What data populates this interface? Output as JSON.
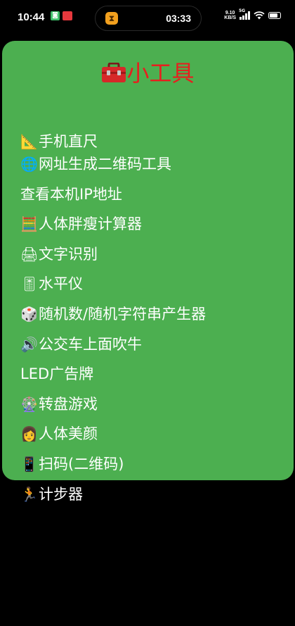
{
  "status_bar": {
    "time": "10:44",
    "timer": "03:33",
    "net_speed_value": "9.10",
    "net_speed_unit": "KB/S",
    "signal_tag": "5G",
    "battery_percent": 85,
    "text_color": "#ffffff"
  },
  "card": {
    "background": "#4caf50",
    "title": "小工具",
    "title_icon": "toolbox-icon",
    "title_color": "#e81e1e",
    "text_color": "#ffffff"
  },
  "tools": [
    {
      "icon": "📐",
      "icon_name": "triangular-ruler-icon",
      "label": "手机直尺"
    },
    {
      "icon": "🌐",
      "icon_name": "globe-icon",
      "label": "网址生成二维码工具"
    },
    {
      "icon": "",
      "icon_name": "",
      "label": "查看本机IP地址"
    },
    {
      "icon": "🧮",
      "icon_name": "abacus-icon",
      "label": "人体胖瘦计算器"
    },
    {
      "icon": "🖨",
      "icon_name": "printer-icon",
      "label": "文字识别"
    },
    {
      "icon": "🎚",
      "icon_name": "level-slider-icon",
      "label": "水平仪"
    },
    {
      "icon": "🎲",
      "icon_name": "dice-icon",
      "label": "随机数/随机字符串产生器"
    },
    {
      "icon": "🔊",
      "icon_name": "speaker-icon",
      "label": "公交车上面吹牛"
    },
    {
      "icon": "",
      "icon_name": "",
      "label": "LED广告牌"
    },
    {
      "icon": "🎡",
      "icon_name": "ferris-wheel-icon",
      "label": "转盘游戏"
    },
    {
      "icon": "👩",
      "icon_name": "woman-icon",
      "label": "人体美颜"
    },
    {
      "icon": "📱",
      "icon_name": "mobile-phone-icon",
      "label": "扫码(二维码)"
    },
    {
      "icon": "🏃",
      "icon_name": "runner-icon",
      "label": "计步器"
    }
  ]
}
